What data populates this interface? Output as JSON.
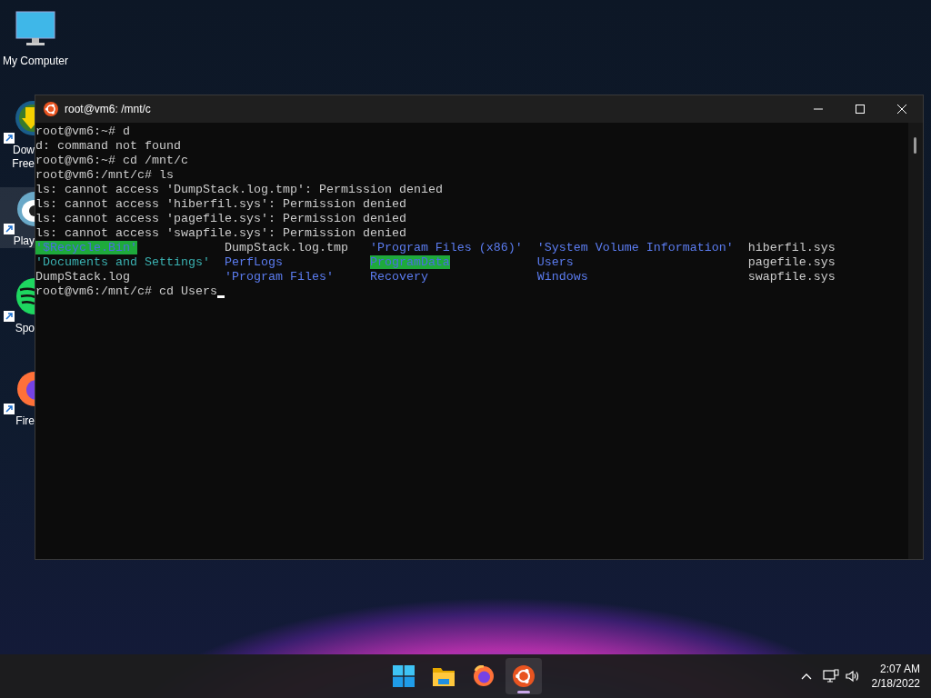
{
  "desktop_icons": [
    {
      "kind": "computer",
      "label_lines": [
        "My Computer"
      ],
      "selected": false
    },
    {
      "kind": "download",
      "label_lines": [
        "Dow",
        "Free"
      ],
      "selected": false
    },
    {
      "kind": "game",
      "label_lines": [
        "Play"
      ],
      "selected": true
    },
    {
      "kind": "music",
      "label_lines": [
        "Spo"
      ],
      "selected": false
    },
    {
      "kind": "browser",
      "label_lines": [
        "Fire"
      ],
      "selected": false
    }
  ],
  "window": {
    "title": "root@vm6: /mnt/c"
  },
  "terminal": {
    "lines": [
      "root@vm6:~# d",
      "d: command not found",
      "root@vm6:~# cd /mnt/c",
      "root@vm6:/mnt/c# ls",
      "ls: cannot access 'DumpStack.log.tmp': Permission denied",
      "ls: cannot access 'hiberfil.sys': Permission denied",
      "ls: cannot access 'pagefile.sys': Permission denied",
      "ls: cannot access 'swapfile.sys': Permission denied"
    ],
    "listing": [
      [
        {
          "text": "'$Recycle.Bin'",
          "kind": "sticky"
        },
        {
          "text": "DumpStack.log.tmp",
          "kind": "file"
        },
        {
          "text": "'Program Files (x86)'",
          "kind": "dir"
        },
        {
          "text": "'System Volume Information'",
          "kind": "dir"
        },
        {
          "text": "hiberfil.sys",
          "kind": "file"
        }
      ],
      [
        {
          "text": "'Documents and Settings'",
          "kind": "link"
        },
        {
          "text": "PerfLogs",
          "kind": "dir"
        },
        {
          "text": "ProgramData",
          "kind": "sticky"
        },
        {
          "text": "Users",
          "kind": "dir"
        },
        {
          "text": "pagefile.sys",
          "kind": "file"
        }
      ],
      [
        {
          "text": "DumpStack.log",
          "kind": "file"
        },
        {
          "text": "'Program Files'",
          "kind": "dir"
        },
        {
          "text": "Recovery",
          "kind": "dir"
        },
        {
          "text": "Windows",
          "kind": "dir"
        },
        {
          "text": "swapfile.sys",
          "kind": "file"
        }
      ]
    ],
    "prompt": "root@vm6:/mnt/c# cd Users",
    "cursor_visible": true
  },
  "taskbar": {
    "apps": [
      {
        "kind": "start",
        "active": false
      },
      {
        "kind": "folder",
        "active": false
      },
      {
        "kind": "browser",
        "active": false
      },
      {
        "kind": "ubuntu",
        "active": true
      }
    ],
    "time": "2:07 AM",
    "date": "2/18/2022"
  }
}
